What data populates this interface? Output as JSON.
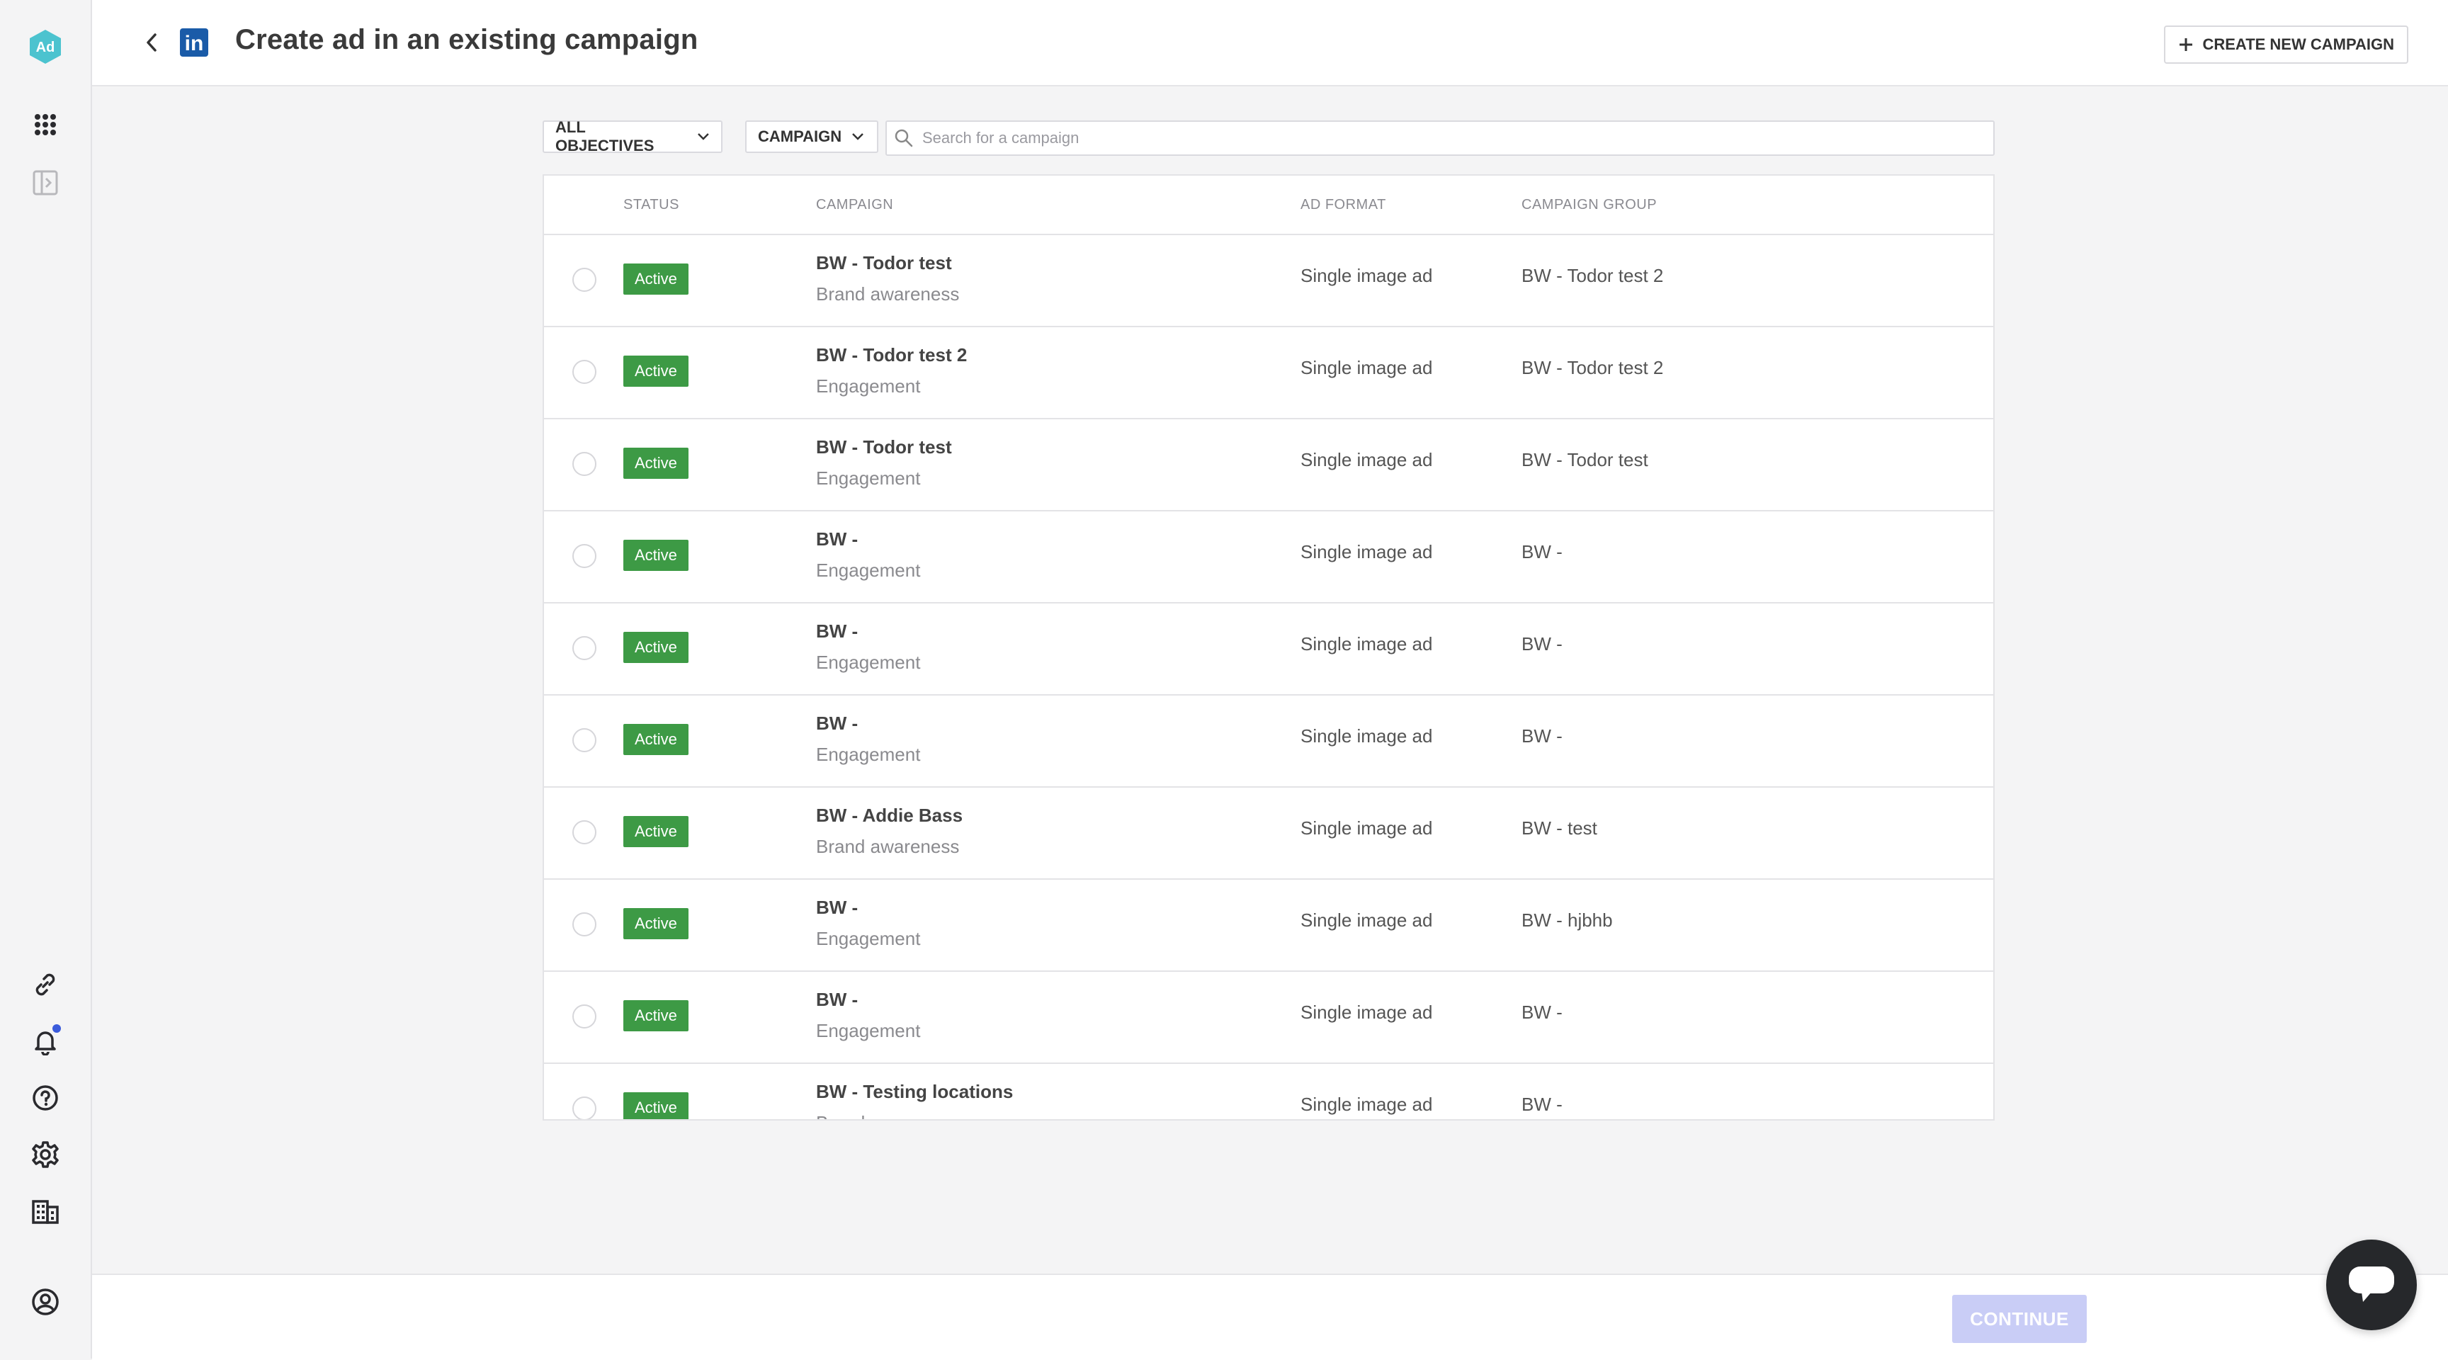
{
  "app": {
    "logo_text": "Ad",
    "accent_color": "#4cc3cf"
  },
  "header": {
    "title": "Create ad in an existing campaign",
    "platform_icon": "linkedin-icon",
    "platform_letters": "in",
    "create_new_label": "CREATE NEW CAMPAIGN"
  },
  "filters": {
    "objectives_label": "ALL OBJECTIVES",
    "level_label": "CAMPAIGN",
    "search_placeholder": "Search for a campaign",
    "search_value": ""
  },
  "table": {
    "columns": {
      "status": "STATUS",
      "campaign": "CAMPAIGN",
      "ad_format": "AD FORMAT",
      "campaign_group": "CAMPAIGN GROUP"
    },
    "rows": [
      {
        "status": "Active",
        "name": "BW - Todor test",
        "objective": "Brand awareness",
        "ad_format": "Single image ad",
        "group": "BW - Todor test 2"
      },
      {
        "status": "Active",
        "name": "BW - Todor test 2",
        "objective": "Engagement",
        "ad_format": "Single image ad",
        "group": "BW - Todor test 2"
      },
      {
        "status": "Active",
        "name": "BW - Todor test",
        "objective": "Engagement",
        "ad_format": "Single image ad",
        "group": "BW - Todor test"
      },
      {
        "status": "Active",
        "name": "BW -",
        "objective": "Engagement",
        "ad_format": "Single image ad",
        "group": "BW -"
      },
      {
        "status": "Active",
        "name": "BW -",
        "objective": "Engagement",
        "ad_format": "Single image ad",
        "group": "BW -"
      },
      {
        "status": "Active",
        "name": "BW -",
        "objective": "Engagement",
        "ad_format": "Single image ad",
        "group": "BW -"
      },
      {
        "status": "Active",
        "name": "BW - Addie Bass",
        "objective": "Brand awareness",
        "ad_format": "Single image ad",
        "group": "BW - test"
      },
      {
        "status": "Active",
        "name": "BW -",
        "objective": "Engagement",
        "ad_format": "Single image ad",
        "group": "BW - hjbhb"
      },
      {
        "status": "Active",
        "name": "BW -",
        "objective": "Engagement",
        "ad_format": "Single image ad",
        "group": "BW -"
      },
      {
        "status": "Active",
        "name": "BW - Testing locations",
        "objective": "Brand awareness",
        "ad_format": "Single image ad",
        "group": "BW -"
      }
    ]
  },
  "footer": {
    "continue_label": "CONTINUE"
  },
  "status_color": "#3d9a45",
  "continue_color": "#c9cdf6"
}
